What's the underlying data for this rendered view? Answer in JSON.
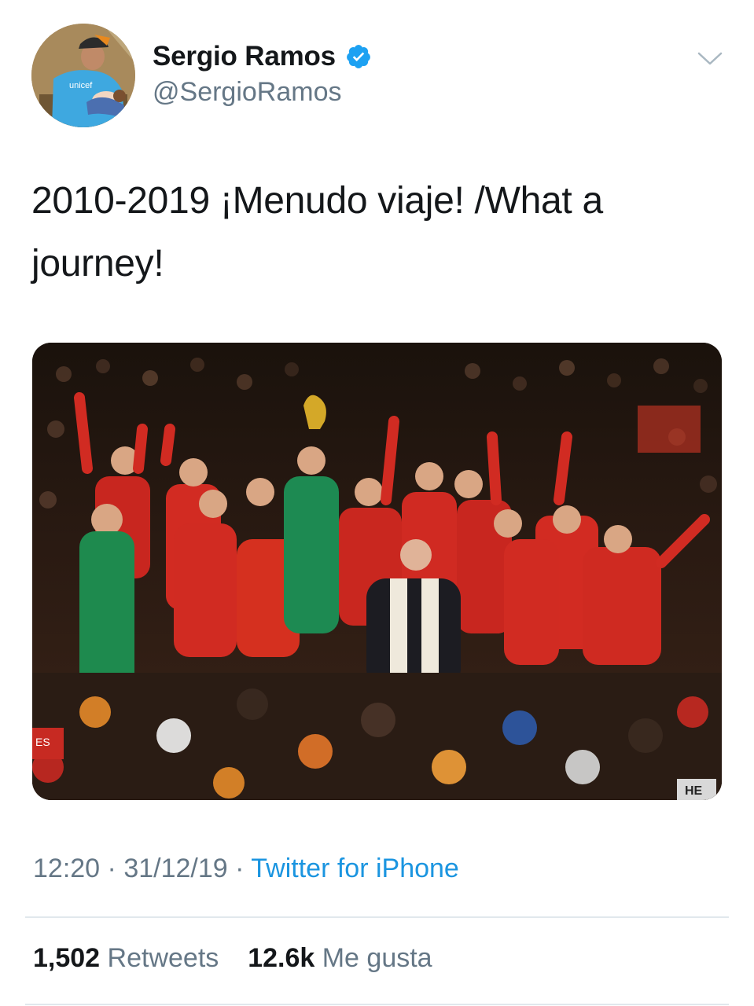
{
  "author": {
    "display_name": "Sergio Ramos",
    "handle": "@SergioRamos",
    "verified": true,
    "avatar_shirt_text": "unicef"
  },
  "tweet": {
    "text": "2010-2019 ¡Menudo viaje! /What a journey!"
  },
  "media": {
    "icon": "photo",
    "scoreboard_text": "ES",
    "camera_text": "HE"
  },
  "meta": {
    "time": "12:20",
    "separator1": " · ",
    "date": "31/12/19",
    "separator2": " · ",
    "source": "Twitter for iPhone"
  },
  "stats": {
    "retweets_count": "1,502",
    "retweets_label": "Retweets",
    "likes_count": "12.6k",
    "likes_label": "Me gusta"
  },
  "colors": {
    "verified_blue": "#1da1f2",
    "link_blue": "#1b95e0",
    "secondary_text": "#657786",
    "primary_text": "#14171a",
    "divider": "#e1e8ed"
  }
}
